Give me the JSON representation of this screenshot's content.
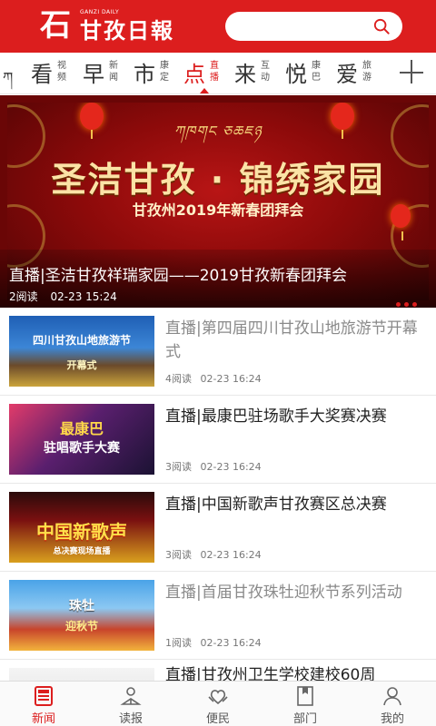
{
  "app": {
    "logo_mark": "石",
    "logo_small": "GANZI DAILY",
    "logo_text": "甘孜日報",
    "brand_color": "#dc1e1e"
  },
  "search": {
    "icon": "search-icon"
  },
  "channels": {
    "tibetan_glyph": "ཀ",
    "items": [
      {
        "big": "看",
        "small": "视频"
      },
      {
        "big": "早",
        "small": "新闻"
      },
      {
        "big": "市",
        "small": "康定"
      },
      {
        "big": "点",
        "small": "直播",
        "active": true
      },
      {
        "big": "来",
        "small": "互动"
      },
      {
        "big": "悦",
        "small": "康巴"
      },
      {
        "big": "爱",
        "small": "旅游"
      }
    ],
    "more_icon": "plus-icon"
  },
  "banner": {
    "deco": "ཀཁགང ཅཆཇཉ",
    "title": "圣洁甘孜 · 锦绣家园",
    "subtitle": "甘孜州2019年新春团拜会",
    "caption": "直播|圣洁甘孜祥瑞家园——2019甘孜新春团拜会",
    "reads": "2阅读",
    "time": "02-23 15:24"
  },
  "list": [
    {
      "title": "直播|第四届四川甘孜山地旅游节开幕式",
      "reads": "4阅读",
      "time": "02-23 16:24",
      "read": true,
      "thumb_text": "四川甘孜山地旅游节",
      "thumb_sub": "开幕式"
    },
    {
      "title": "直播|最康巴驻场歌手大奖赛决赛",
      "reads": "3阅读",
      "time": "02-23 16:24",
      "read": false,
      "thumb_text": "最康巴",
      "thumb_sub": "驻唱歌手大赛"
    },
    {
      "title": "直播|中国新歌声甘孜赛区总决赛",
      "reads": "3阅读",
      "time": "02-23 16:24",
      "read": false,
      "thumb_text": "中国新歌声",
      "thumb_sub": "总决赛现场直播"
    },
    {
      "title": "直播|首届甘孜珠牡迎秋节系列活动",
      "reads": "1阅读",
      "time": "02-23 16:24",
      "read": true,
      "thumb_text": "珠牡",
      "thumb_sub": "迎秋节"
    },
    {
      "title": "直播|甘孜州卫生学校建校60周",
      "reads": "",
      "time": "",
      "read": false,
      "thumb_text": "",
      "thumb_sub": ""
    }
  ],
  "bottom_nav": [
    {
      "label": "新闻",
      "icon": "news-icon",
      "active": true
    },
    {
      "label": "读报",
      "icon": "read-paper-icon"
    },
    {
      "label": "便民",
      "icon": "service-icon"
    },
    {
      "label": "部门",
      "icon": "department-icon"
    },
    {
      "label": "我的",
      "icon": "profile-icon"
    }
  ]
}
